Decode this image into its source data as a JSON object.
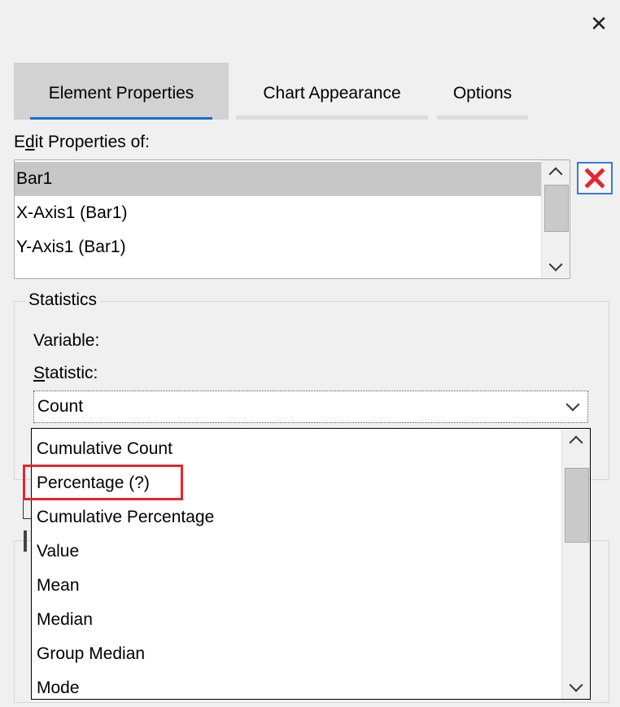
{
  "window": {
    "close_glyph": "✕"
  },
  "tabs": [
    {
      "label": "Element Properties",
      "active": true
    },
    {
      "label": "Chart Appearance",
      "active": false
    },
    {
      "label": "Options",
      "active": false
    }
  ],
  "edit_properties": {
    "label_prefix": "E",
    "label_underlined": "d",
    "label_suffix": "it Properties of:",
    "items": [
      "Bar1",
      "X-Axis1 (Bar1)",
      "Y-Axis1 (Bar1)"
    ],
    "selected": "Bar1",
    "delete_icon": "red-x-icon",
    "delete_color": "#e8242c"
  },
  "statistics": {
    "legend": "Statistics",
    "variable_label": "Variable:",
    "statistic_label_underlined": "S",
    "statistic_label_suffix": "tatistic:",
    "selected_value": "Count",
    "options": [
      "Cumulative Count",
      "Percentage (?)",
      "Cumulative Percentage",
      "Value",
      "Mean",
      "Median",
      "Group Median",
      "Mode"
    ],
    "highlighted_option": "Percentage (?)",
    "highlight_color": "#e8242c"
  },
  "colors": {
    "accent": "#1a6dd4",
    "selection": "#c7c7c7"
  }
}
